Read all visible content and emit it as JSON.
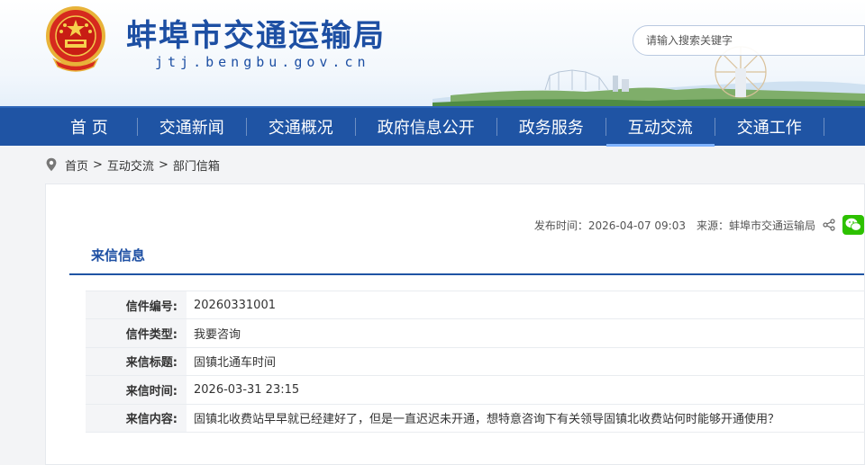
{
  "header": {
    "site_title": "蚌埠市交通运输局",
    "site_domain": "jtj.bengbu.gov.cn",
    "search_placeholder": "请输入搜索关键字"
  },
  "nav": {
    "items": [
      {
        "label": "首 页"
      },
      {
        "label": "交通新闻"
      },
      {
        "label": "交通概况"
      },
      {
        "label": "政府信息公开"
      },
      {
        "label": "政务服务"
      },
      {
        "label": "互动交流"
      },
      {
        "label": "交通工作"
      }
    ],
    "active_index": 5
  },
  "breadcrumb": {
    "items": [
      "首页",
      "互动交流",
      "部门信箱"
    ],
    "separator": ">"
  },
  "meta": {
    "publish_time": "发布时间：2026-04-07 09:03",
    "source": "来源：蚌埠市交通运输局"
  },
  "section": {
    "title": "来信信息"
  },
  "letter": {
    "rows": [
      {
        "label": "信件编号:",
        "value": "20260331001"
      },
      {
        "label": "信件类型:",
        "value": "我要咨询"
      },
      {
        "label": "来信标题:",
        "value": "固镇北通车时间"
      },
      {
        "label": "来信时间:",
        "value": "2026-03-31 23:15"
      },
      {
        "label": "来信内容:",
        "value": "固镇北收费站早早就已经建好了，但是一直迟迟未开通，想特意咨询下有关领导固镇北收费站何时能够开通使用？"
      }
    ]
  },
  "colors": {
    "nav_bg": "#1f54a4",
    "title_blue": "#1d4fa3",
    "wechat_green": "#2dc100"
  },
  "icons": {
    "emblem": "national-emblem",
    "breadcrumb": "location-pin-icon",
    "share": "share-icon",
    "wechat": "wechat-icon"
  }
}
